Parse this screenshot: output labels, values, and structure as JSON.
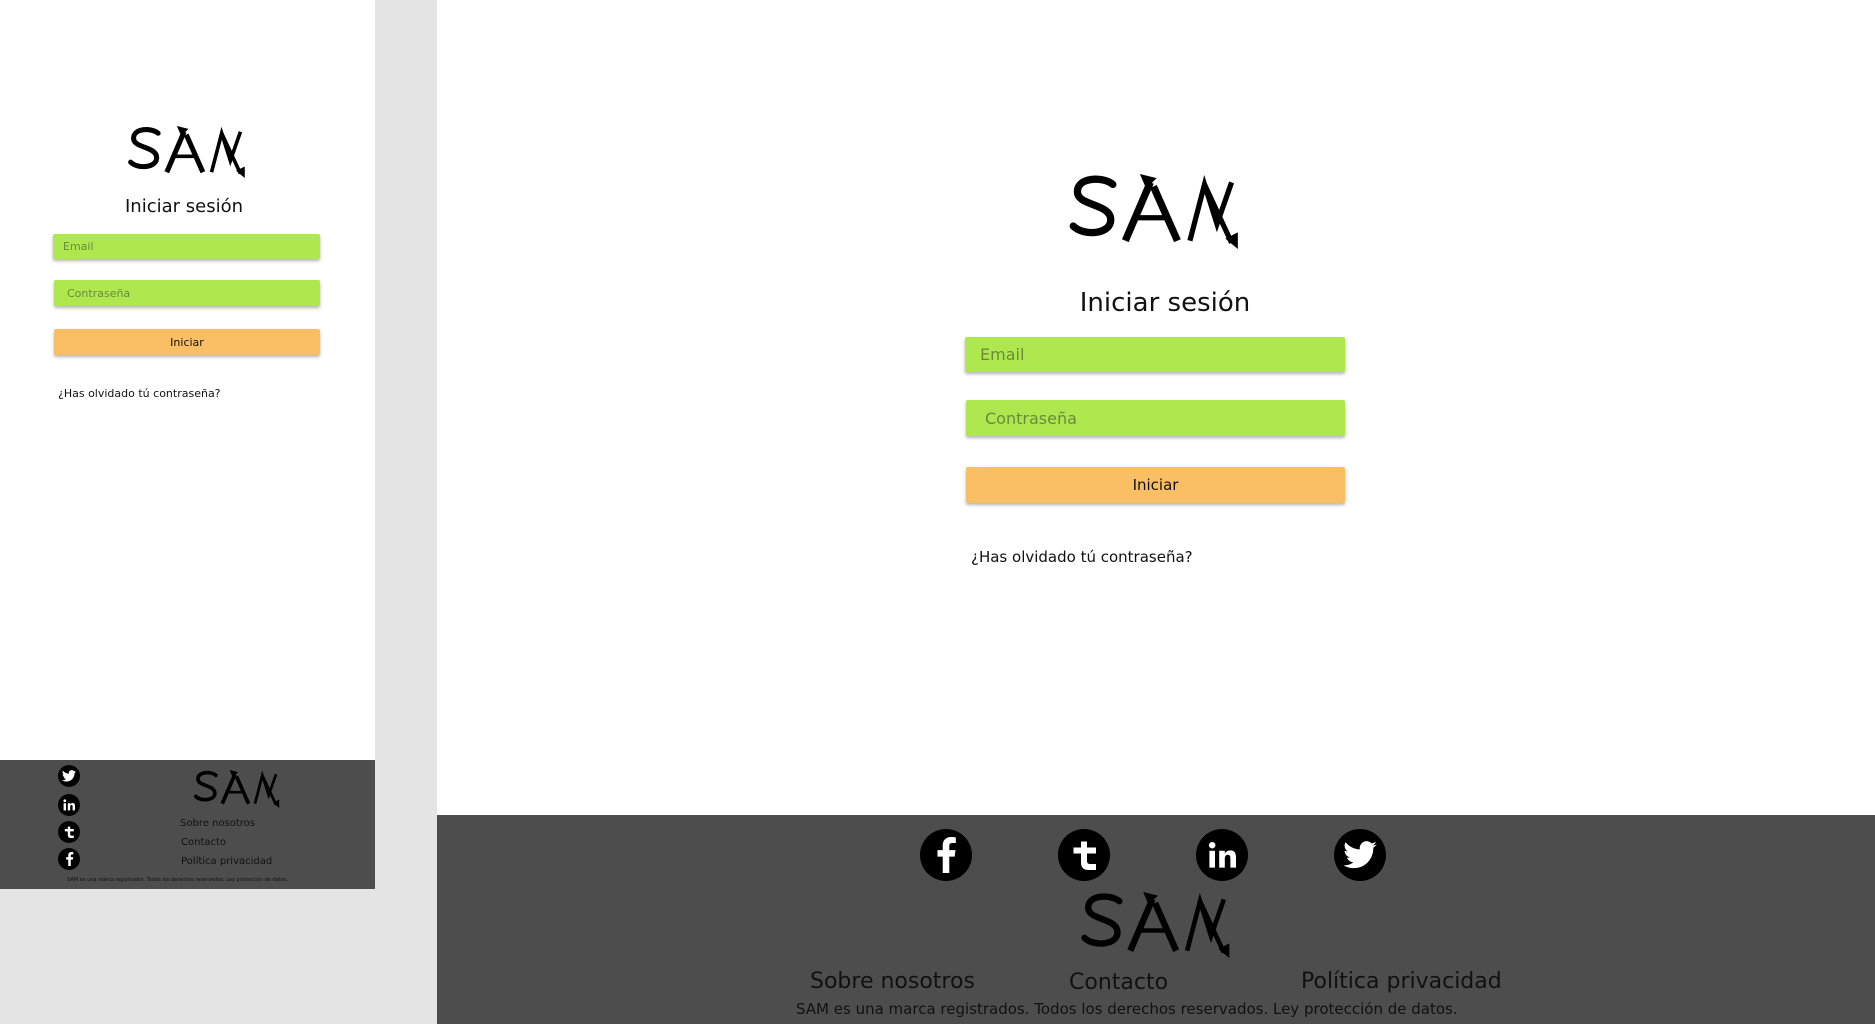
{
  "brand": {
    "logo_text": "SAM"
  },
  "login": {
    "title": "Iniciar sesión",
    "email_placeholder": "Email",
    "password_placeholder": "Contraseña",
    "submit_label": "Iniciar",
    "forgot_link": "¿Has olvidado tú contraseña?"
  },
  "footer": {
    "social_mobile": [
      "twitter-icon",
      "linkedin-icon",
      "tumblr-icon",
      "facebook-icon"
    ],
    "social_desktop": [
      "facebook-icon",
      "tumblr-icon",
      "linkedin-icon",
      "twitter-icon"
    ],
    "links": [
      "Sobre nosotros",
      "Contacto",
      "Política privacidad"
    ],
    "copyright": "SAM es una marca registrados. Todos los derechos reservados. Ley protección de datos."
  },
  "colors": {
    "input_bg": "#aee84e",
    "button_bg": "#fabe64",
    "footer_bg": "#4d4d4d",
    "gutter_bg": "#e4e4e4"
  }
}
